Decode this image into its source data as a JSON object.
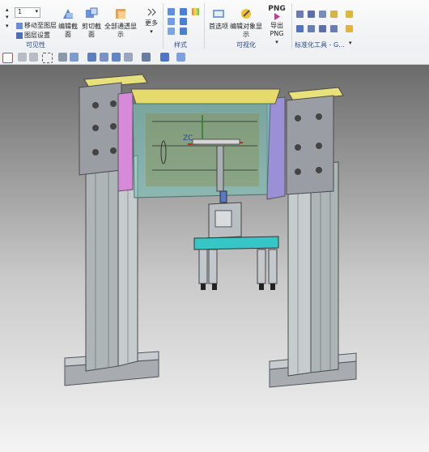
{
  "ribbon": {
    "layer_value": "1",
    "move_to_layer": "移动至图层",
    "layer_settings": "图层设置",
    "group_visibility": "可见性",
    "edit_section": "编辑截面",
    "clip_section": "剪切截面",
    "show_all_transparent": "全部通透显示",
    "more": "更多",
    "group_style": "样式",
    "preferences": "首选项",
    "edit_object_display": "编辑对象显示",
    "export_png_icon_text": "PNG",
    "export_png": "导出 PNG",
    "group_visualization": "可视化",
    "group_standard_tools": "标准化工具 - G..."
  },
  "colors": {
    "accent_blue": "#2a4a8a",
    "frame_grey": "#9a9ea4",
    "plate_yellow": "#e8e07a",
    "glass_teal": "#79c7bc",
    "side_purple": "#9b8fd6",
    "side_magenta": "#d78ad9",
    "cyan_bar": "#36c6c6"
  }
}
